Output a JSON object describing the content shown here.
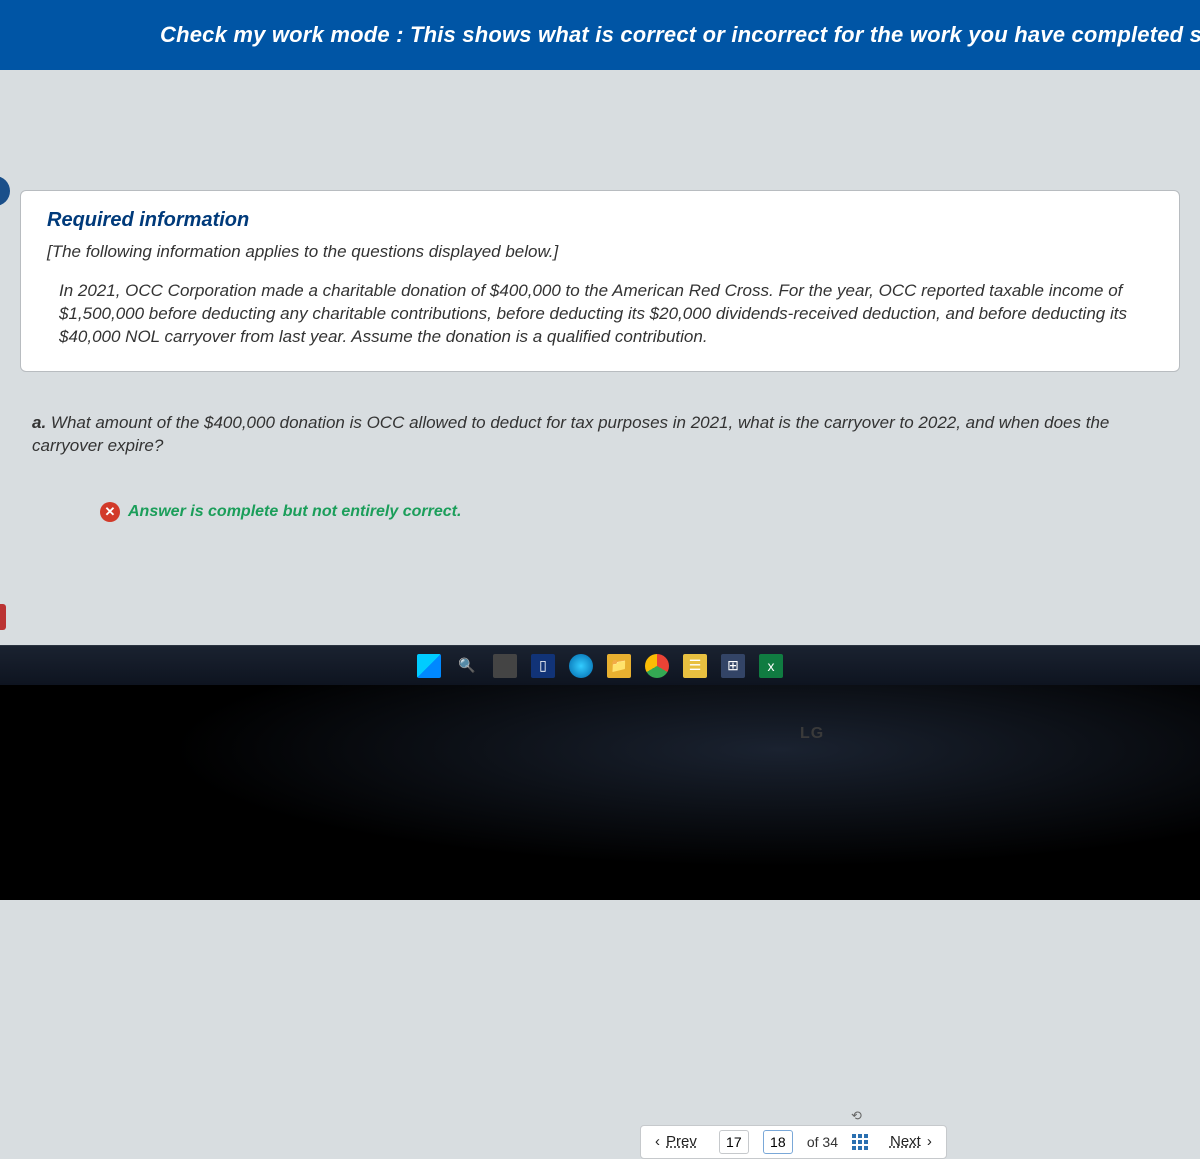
{
  "banner": {
    "text": "Check my work mode : This shows what is correct or incorrect for the work you have completed so"
  },
  "card": {
    "title": "Required information",
    "applies": "[The following information applies to the questions displayed below.]",
    "body": "In 2021, OCC Corporation made a charitable donation of $400,000 to the American Red Cross. For the year, OCC reported taxable income of $1,500,000 before deducting any charitable contributions, before deducting its $20,000 dividends-received deduction, and before deducting its $40,000 NOL carryover from last year. Assume the donation is a qualified contribution."
  },
  "question": {
    "label": "a.",
    "text": "What amount of the $400,000 donation is OCC allowed to deduct for tax purposes in 2021, what is the carryover to 2022, and when does the carryover expire?"
  },
  "feedback": {
    "icon": "✕",
    "text": "Answer is complete but not entirely correct."
  },
  "pager": {
    "prev": "Prev",
    "next": "Next",
    "page1": "17",
    "page2": "18",
    "of": "of 34",
    "link_icon": "⟲"
  },
  "monitor": {
    "brand": "LG"
  }
}
